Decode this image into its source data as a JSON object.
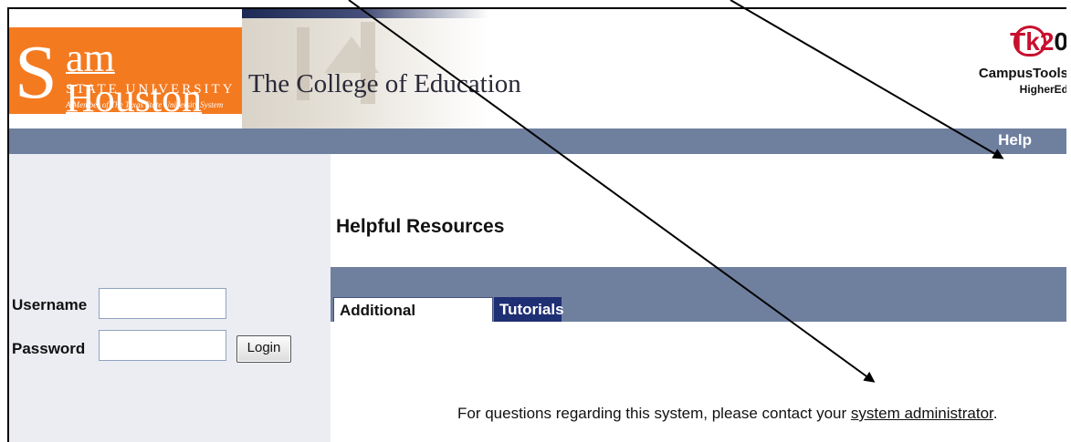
{
  "header": {
    "logo_letter": "S",
    "logo_name": "am Houston",
    "logo_university": "STATE UNIVERSITY",
    "logo_member": "A Member of The Texas State University System",
    "college_title": "The College of Education",
    "tk_brand_main": "Tk2",
    "tk_brand_zero": "0",
    "tk_campustools": "CampusTools",
    "tk_highered": "HigherEd",
    "brand_color": "#f47a20",
    "nav_color": "#6f7f9e"
  },
  "nav": {
    "help_label": "Help"
  },
  "login": {
    "username_label": "Username",
    "password_label": "Password",
    "username_value": "",
    "password_value": "",
    "login_button": "Login"
  },
  "main": {
    "title": "Helpful Resources",
    "tabs": [
      {
        "label": "Additional Information",
        "active": true
      },
      {
        "label": "Tutorials",
        "active": false
      }
    ],
    "contact_prefix": "For questions regarding this system, please contact your ",
    "contact_link": "system administrator",
    "contact_suffix": "."
  }
}
